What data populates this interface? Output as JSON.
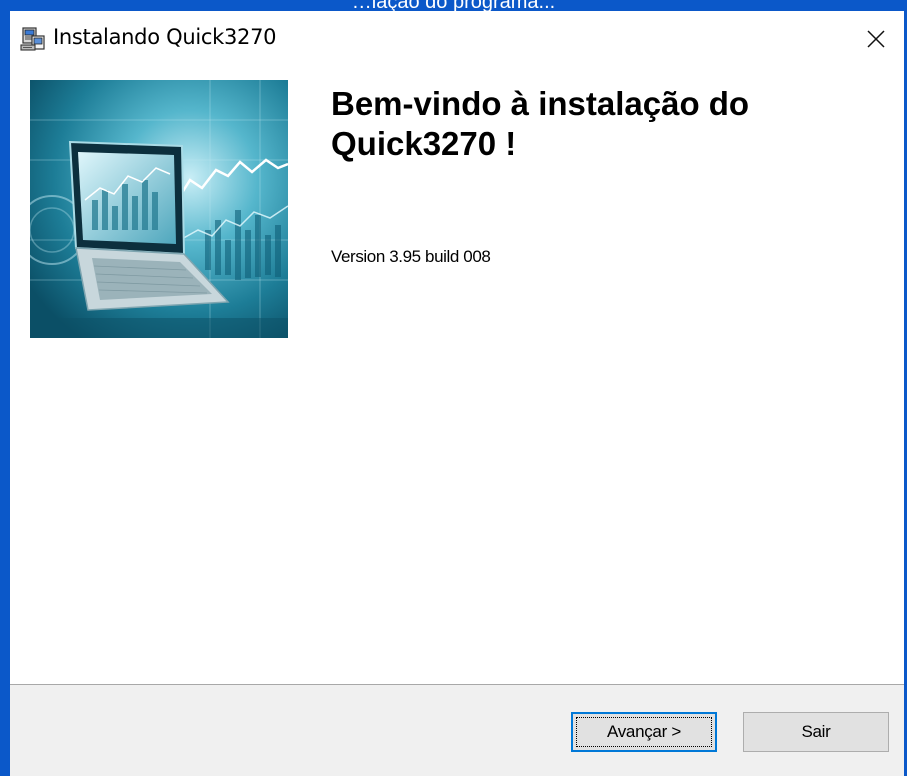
{
  "background": {
    "text": "…lação do programa...",
    "color": "#0b58c9"
  },
  "window": {
    "title": "Instalando Quick3270",
    "icon": "installer-computer-icon",
    "close_icon": "close-icon"
  },
  "content": {
    "hero_image": "laptop-stock-chart-image",
    "heading": "Bem-vindo à instalação do Quick3270 !",
    "version": "Version 3.95 build 008"
  },
  "footer": {
    "next_label": "Avançar >",
    "exit_label": "Sair"
  },
  "colors": {
    "accent": "#0078d7",
    "footer_bg": "#f0f0f0",
    "button_bg": "#e1e1e1"
  }
}
